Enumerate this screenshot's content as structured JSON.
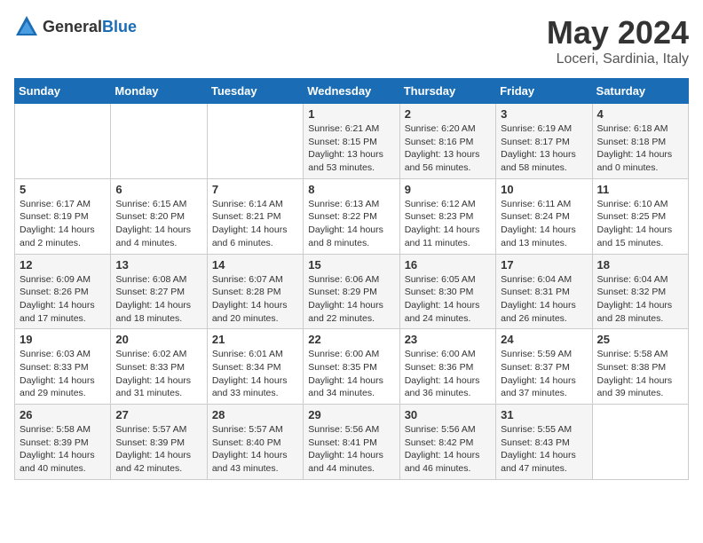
{
  "logo": {
    "general": "General",
    "blue": "Blue"
  },
  "title": "May 2024",
  "subtitle": "Loceri, Sardinia, Italy",
  "days_header": [
    "Sunday",
    "Monday",
    "Tuesday",
    "Wednesday",
    "Thursday",
    "Friday",
    "Saturday"
  ],
  "weeks": [
    [
      {
        "day": "",
        "content": ""
      },
      {
        "day": "",
        "content": ""
      },
      {
        "day": "",
        "content": ""
      },
      {
        "day": "1",
        "content": "Sunrise: 6:21 AM\nSunset: 8:15 PM\nDaylight: 13 hours\nand 53 minutes."
      },
      {
        "day": "2",
        "content": "Sunrise: 6:20 AM\nSunset: 8:16 PM\nDaylight: 13 hours\nand 56 minutes."
      },
      {
        "day": "3",
        "content": "Sunrise: 6:19 AM\nSunset: 8:17 PM\nDaylight: 13 hours\nand 58 minutes."
      },
      {
        "day": "4",
        "content": "Sunrise: 6:18 AM\nSunset: 8:18 PM\nDaylight: 14 hours\nand 0 minutes."
      }
    ],
    [
      {
        "day": "5",
        "content": "Sunrise: 6:17 AM\nSunset: 8:19 PM\nDaylight: 14 hours\nand 2 minutes."
      },
      {
        "day": "6",
        "content": "Sunrise: 6:15 AM\nSunset: 8:20 PM\nDaylight: 14 hours\nand 4 minutes."
      },
      {
        "day": "7",
        "content": "Sunrise: 6:14 AM\nSunset: 8:21 PM\nDaylight: 14 hours\nand 6 minutes."
      },
      {
        "day": "8",
        "content": "Sunrise: 6:13 AM\nSunset: 8:22 PM\nDaylight: 14 hours\nand 8 minutes."
      },
      {
        "day": "9",
        "content": "Sunrise: 6:12 AM\nSunset: 8:23 PM\nDaylight: 14 hours\nand 11 minutes."
      },
      {
        "day": "10",
        "content": "Sunrise: 6:11 AM\nSunset: 8:24 PM\nDaylight: 14 hours\nand 13 minutes."
      },
      {
        "day": "11",
        "content": "Sunrise: 6:10 AM\nSunset: 8:25 PM\nDaylight: 14 hours\nand 15 minutes."
      }
    ],
    [
      {
        "day": "12",
        "content": "Sunrise: 6:09 AM\nSunset: 8:26 PM\nDaylight: 14 hours\nand 17 minutes."
      },
      {
        "day": "13",
        "content": "Sunrise: 6:08 AM\nSunset: 8:27 PM\nDaylight: 14 hours\nand 18 minutes."
      },
      {
        "day": "14",
        "content": "Sunrise: 6:07 AM\nSunset: 8:28 PM\nDaylight: 14 hours\nand 20 minutes."
      },
      {
        "day": "15",
        "content": "Sunrise: 6:06 AM\nSunset: 8:29 PM\nDaylight: 14 hours\nand 22 minutes."
      },
      {
        "day": "16",
        "content": "Sunrise: 6:05 AM\nSunset: 8:30 PM\nDaylight: 14 hours\nand 24 minutes."
      },
      {
        "day": "17",
        "content": "Sunrise: 6:04 AM\nSunset: 8:31 PM\nDaylight: 14 hours\nand 26 minutes."
      },
      {
        "day": "18",
        "content": "Sunrise: 6:04 AM\nSunset: 8:32 PM\nDaylight: 14 hours\nand 28 minutes."
      }
    ],
    [
      {
        "day": "19",
        "content": "Sunrise: 6:03 AM\nSunset: 8:33 PM\nDaylight: 14 hours\nand 29 minutes."
      },
      {
        "day": "20",
        "content": "Sunrise: 6:02 AM\nSunset: 8:33 PM\nDaylight: 14 hours\nand 31 minutes."
      },
      {
        "day": "21",
        "content": "Sunrise: 6:01 AM\nSunset: 8:34 PM\nDaylight: 14 hours\nand 33 minutes."
      },
      {
        "day": "22",
        "content": "Sunrise: 6:00 AM\nSunset: 8:35 PM\nDaylight: 14 hours\nand 34 minutes."
      },
      {
        "day": "23",
        "content": "Sunrise: 6:00 AM\nSunset: 8:36 PM\nDaylight: 14 hours\nand 36 minutes."
      },
      {
        "day": "24",
        "content": "Sunrise: 5:59 AM\nSunset: 8:37 PM\nDaylight: 14 hours\nand 37 minutes."
      },
      {
        "day": "25",
        "content": "Sunrise: 5:58 AM\nSunset: 8:38 PM\nDaylight: 14 hours\nand 39 minutes."
      }
    ],
    [
      {
        "day": "26",
        "content": "Sunrise: 5:58 AM\nSunset: 8:39 PM\nDaylight: 14 hours\nand 40 minutes."
      },
      {
        "day": "27",
        "content": "Sunrise: 5:57 AM\nSunset: 8:39 PM\nDaylight: 14 hours\nand 42 minutes."
      },
      {
        "day": "28",
        "content": "Sunrise: 5:57 AM\nSunset: 8:40 PM\nDaylight: 14 hours\nand 43 minutes."
      },
      {
        "day": "29",
        "content": "Sunrise: 5:56 AM\nSunset: 8:41 PM\nDaylight: 14 hours\nand 44 minutes."
      },
      {
        "day": "30",
        "content": "Sunrise: 5:56 AM\nSunset: 8:42 PM\nDaylight: 14 hours\nand 46 minutes."
      },
      {
        "day": "31",
        "content": "Sunrise: 5:55 AM\nSunset: 8:43 PM\nDaylight: 14 hours\nand 47 minutes."
      },
      {
        "day": "",
        "content": ""
      }
    ]
  ]
}
